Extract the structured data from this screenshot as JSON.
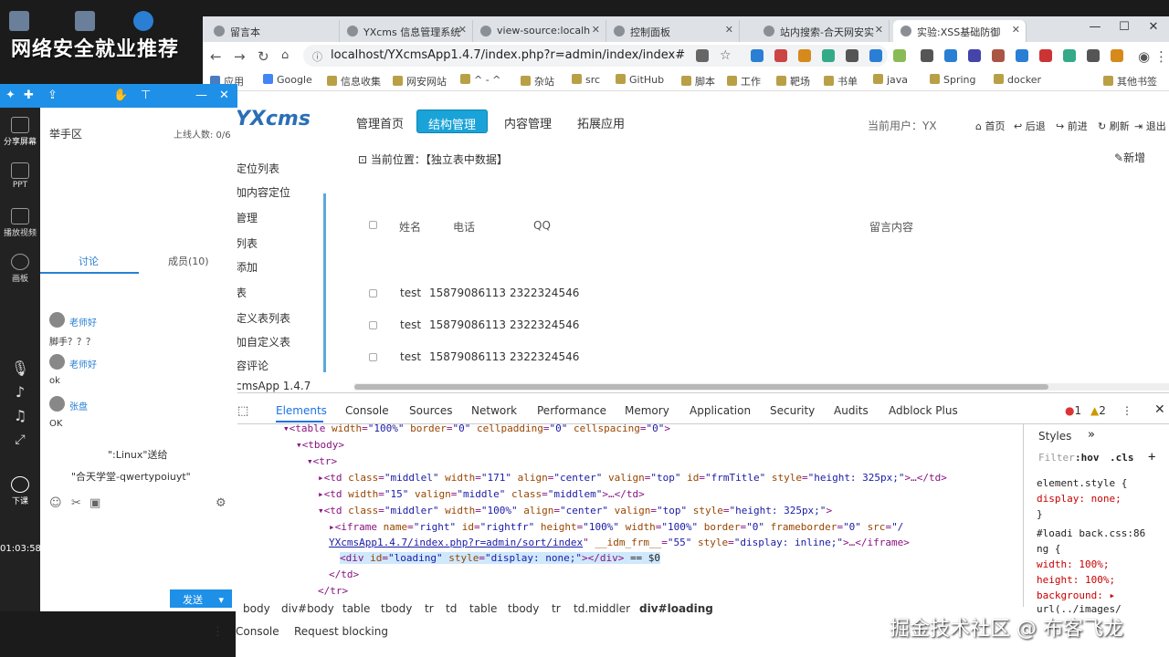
{
  "desktop": {
    "title": "网络安全就业推荐"
  },
  "browser": {
    "tabs": [
      {
        "label": "留言本"
      },
      {
        "label": "YXcms 信息管理系统"
      },
      {
        "label": "view-source:localh"
      },
      {
        "label": "控制面板"
      },
      {
        "label": "站内搜索-合天网安实"
      },
      {
        "label": "实验:XSS基础防御"
      }
    ],
    "url": "localhost/YXcmsApp1.4.7/index.php?r=admin/index/index#",
    "bookmarks": [
      "应用",
      "Google",
      "信息收集",
      "网安网站",
      "^ - ^",
      "杂站",
      "src",
      "GitHub",
      "脚本",
      "工作",
      "靶场",
      "书单",
      "java",
      "Spring",
      "docker",
      "其他书签"
    ]
  },
  "page": {
    "logo": "YXcms",
    "nav": [
      "管理首页",
      "结构管理",
      "内容管理",
      "拓展应用"
    ],
    "current_user": "当前用户：YX",
    "top_links": [
      "首页",
      "后退",
      "前进",
      "刷新",
      "退出"
    ],
    "sidebar": [
      "定位列表",
      "加内容定位",
      "管理",
      "列表",
      "添加",
      "表",
      "定义表列表",
      "加自定义表",
      "容评论",
      "cmsApp 1.4.7"
    ],
    "breadcrumb": "当前位置：【独立表中数据】",
    "add_new": "新增",
    "columns": [
      "姓名",
      "电话",
      "QQ",
      "留言内容"
    ],
    "rows": [
      {
        "name": "test",
        "phone": "15879086113",
        "qq": "2322324546"
      },
      {
        "name": "test",
        "phone": "15879086113",
        "qq": "2322324546"
      },
      {
        "name": "test",
        "phone": "15879086113",
        "qq": "2322324546"
      }
    ]
  },
  "devtools": {
    "tabs": [
      "Elements",
      "Console",
      "Sources",
      "Network",
      "Performance",
      "Memory",
      "Application",
      "Security",
      "Audits",
      "Adblock Plus"
    ],
    "errors": "1",
    "warnings": "2",
    "styles_tab": "Styles",
    "filter": "Filter",
    "hov": ":hov",
    "cls": ".cls",
    "breadcrumb": [
      "body",
      "div#body",
      "table",
      "tbody",
      "tr",
      "td",
      "table",
      "tbody",
      "tr",
      "td.middler",
      "div#loading"
    ],
    "drawer": [
      "Console",
      "Request blocking"
    ],
    "styles": [
      "element.style {",
      "  display: none;",
      "}",
      "#loadi  back.css:86",
      "ng {",
      "  width: 100%;",
      "  height: 100%;",
      "  background: ▸",
      "    url(../images/"
    ]
  },
  "chat": {
    "header": "举手区",
    "online": "上线人数: 0/6",
    "tab_discuss": "讨论",
    "tab_members": "成员(10)",
    "messages": [
      {
        "name": "老师好",
        "text": "脚手？？？"
      },
      {
        "name": "老师好",
        "text": "ok"
      },
      {
        "name": "张盘",
        "text": "OK"
      }
    ],
    "gift1": "\":Linux\"送给",
    "gift2": "\"合天学堂-qwertypoiuyt\"",
    "send": "发送",
    "rail": [
      "分享屏幕",
      "PPT",
      "播放视频",
      "画板"
    ],
    "timer": "01:03:58",
    "leave": "下课"
  },
  "watermark": "掘金技术社区 @ 布客飞龙"
}
